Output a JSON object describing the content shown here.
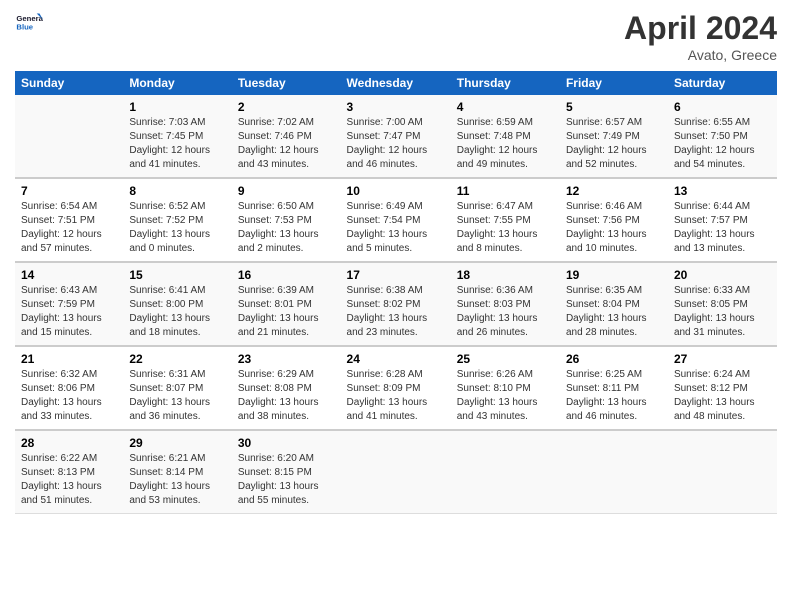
{
  "header": {
    "logo_general": "General",
    "logo_blue": "Blue",
    "title": "April 2024",
    "location": "Avato, Greece"
  },
  "days_of_week": [
    "Sunday",
    "Monday",
    "Tuesday",
    "Wednesday",
    "Thursday",
    "Friday",
    "Saturday"
  ],
  "weeks": [
    [
      {
        "day": "",
        "sunrise": "",
        "sunset": "",
        "daylight": ""
      },
      {
        "day": "1",
        "sunrise": "Sunrise: 7:03 AM",
        "sunset": "Sunset: 7:45 PM",
        "daylight": "Daylight: 12 hours and 41 minutes."
      },
      {
        "day": "2",
        "sunrise": "Sunrise: 7:02 AM",
        "sunset": "Sunset: 7:46 PM",
        "daylight": "Daylight: 12 hours and 43 minutes."
      },
      {
        "day": "3",
        "sunrise": "Sunrise: 7:00 AM",
        "sunset": "Sunset: 7:47 PM",
        "daylight": "Daylight: 12 hours and 46 minutes."
      },
      {
        "day": "4",
        "sunrise": "Sunrise: 6:59 AM",
        "sunset": "Sunset: 7:48 PM",
        "daylight": "Daylight: 12 hours and 49 minutes."
      },
      {
        "day": "5",
        "sunrise": "Sunrise: 6:57 AM",
        "sunset": "Sunset: 7:49 PM",
        "daylight": "Daylight: 12 hours and 52 minutes."
      },
      {
        "day": "6",
        "sunrise": "Sunrise: 6:55 AM",
        "sunset": "Sunset: 7:50 PM",
        "daylight": "Daylight: 12 hours and 54 minutes."
      }
    ],
    [
      {
        "day": "7",
        "sunrise": "Sunrise: 6:54 AM",
        "sunset": "Sunset: 7:51 PM",
        "daylight": "Daylight: 12 hours and 57 minutes."
      },
      {
        "day": "8",
        "sunrise": "Sunrise: 6:52 AM",
        "sunset": "Sunset: 7:52 PM",
        "daylight": "Daylight: 13 hours and 0 minutes."
      },
      {
        "day": "9",
        "sunrise": "Sunrise: 6:50 AM",
        "sunset": "Sunset: 7:53 PM",
        "daylight": "Daylight: 13 hours and 2 minutes."
      },
      {
        "day": "10",
        "sunrise": "Sunrise: 6:49 AM",
        "sunset": "Sunset: 7:54 PM",
        "daylight": "Daylight: 13 hours and 5 minutes."
      },
      {
        "day": "11",
        "sunrise": "Sunrise: 6:47 AM",
        "sunset": "Sunset: 7:55 PM",
        "daylight": "Daylight: 13 hours and 8 minutes."
      },
      {
        "day": "12",
        "sunrise": "Sunrise: 6:46 AM",
        "sunset": "Sunset: 7:56 PM",
        "daylight": "Daylight: 13 hours and 10 minutes."
      },
      {
        "day": "13",
        "sunrise": "Sunrise: 6:44 AM",
        "sunset": "Sunset: 7:57 PM",
        "daylight": "Daylight: 13 hours and 13 minutes."
      }
    ],
    [
      {
        "day": "14",
        "sunrise": "Sunrise: 6:43 AM",
        "sunset": "Sunset: 7:59 PM",
        "daylight": "Daylight: 13 hours and 15 minutes."
      },
      {
        "day": "15",
        "sunrise": "Sunrise: 6:41 AM",
        "sunset": "Sunset: 8:00 PM",
        "daylight": "Daylight: 13 hours and 18 minutes."
      },
      {
        "day": "16",
        "sunrise": "Sunrise: 6:39 AM",
        "sunset": "Sunset: 8:01 PM",
        "daylight": "Daylight: 13 hours and 21 minutes."
      },
      {
        "day": "17",
        "sunrise": "Sunrise: 6:38 AM",
        "sunset": "Sunset: 8:02 PM",
        "daylight": "Daylight: 13 hours and 23 minutes."
      },
      {
        "day": "18",
        "sunrise": "Sunrise: 6:36 AM",
        "sunset": "Sunset: 8:03 PM",
        "daylight": "Daylight: 13 hours and 26 minutes."
      },
      {
        "day": "19",
        "sunrise": "Sunrise: 6:35 AM",
        "sunset": "Sunset: 8:04 PM",
        "daylight": "Daylight: 13 hours and 28 minutes."
      },
      {
        "day": "20",
        "sunrise": "Sunrise: 6:33 AM",
        "sunset": "Sunset: 8:05 PM",
        "daylight": "Daylight: 13 hours and 31 minutes."
      }
    ],
    [
      {
        "day": "21",
        "sunrise": "Sunrise: 6:32 AM",
        "sunset": "Sunset: 8:06 PM",
        "daylight": "Daylight: 13 hours and 33 minutes."
      },
      {
        "day": "22",
        "sunrise": "Sunrise: 6:31 AM",
        "sunset": "Sunset: 8:07 PM",
        "daylight": "Daylight: 13 hours and 36 minutes."
      },
      {
        "day": "23",
        "sunrise": "Sunrise: 6:29 AM",
        "sunset": "Sunset: 8:08 PM",
        "daylight": "Daylight: 13 hours and 38 minutes."
      },
      {
        "day": "24",
        "sunrise": "Sunrise: 6:28 AM",
        "sunset": "Sunset: 8:09 PM",
        "daylight": "Daylight: 13 hours and 41 minutes."
      },
      {
        "day": "25",
        "sunrise": "Sunrise: 6:26 AM",
        "sunset": "Sunset: 8:10 PM",
        "daylight": "Daylight: 13 hours and 43 minutes."
      },
      {
        "day": "26",
        "sunrise": "Sunrise: 6:25 AM",
        "sunset": "Sunset: 8:11 PM",
        "daylight": "Daylight: 13 hours and 46 minutes."
      },
      {
        "day": "27",
        "sunrise": "Sunrise: 6:24 AM",
        "sunset": "Sunset: 8:12 PM",
        "daylight": "Daylight: 13 hours and 48 minutes."
      }
    ],
    [
      {
        "day": "28",
        "sunrise": "Sunrise: 6:22 AM",
        "sunset": "Sunset: 8:13 PM",
        "daylight": "Daylight: 13 hours and 51 minutes."
      },
      {
        "day": "29",
        "sunrise": "Sunrise: 6:21 AM",
        "sunset": "Sunset: 8:14 PM",
        "daylight": "Daylight: 13 hours and 53 minutes."
      },
      {
        "day": "30",
        "sunrise": "Sunrise: 6:20 AM",
        "sunset": "Sunset: 8:15 PM",
        "daylight": "Daylight: 13 hours and 55 minutes."
      },
      {
        "day": "",
        "sunrise": "",
        "sunset": "",
        "daylight": ""
      },
      {
        "day": "",
        "sunrise": "",
        "sunset": "",
        "daylight": ""
      },
      {
        "day": "",
        "sunrise": "",
        "sunset": "",
        "daylight": ""
      },
      {
        "day": "",
        "sunrise": "",
        "sunset": "",
        "daylight": ""
      }
    ]
  ]
}
